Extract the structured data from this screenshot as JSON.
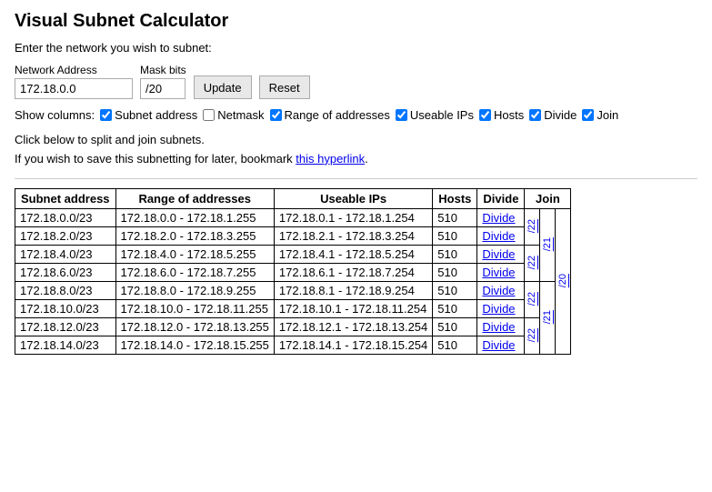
{
  "title": "Visual Subnet Calculator",
  "subtitle": "Enter the network you wish to subnet:",
  "network_label": "Network Address",
  "mask_label": "Mask bits",
  "network_value": "172.18.0.0",
  "mask_value": "/20",
  "update_btn": "Update",
  "reset_btn": "Reset",
  "show_columns_label": "Show columns:",
  "columns": [
    {
      "id": "subnet",
      "label": "Subnet address",
      "checked": true
    },
    {
      "id": "netmask",
      "label": "Netmask",
      "checked": false
    },
    {
      "id": "range",
      "label": "Range of addresses",
      "checked": true
    },
    {
      "id": "useable",
      "label": "Useable IPs",
      "checked": true
    },
    {
      "id": "hosts",
      "label": "Hosts",
      "checked": true
    },
    {
      "id": "divide",
      "label": "Divide",
      "checked": true
    },
    {
      "id": "join",
      "label": "Join",
      "checked": true
    }
  ],
  "info_line1": "Click below to split and join subnets.",
  "info_line2": "If you wish to save this subnetting for later, bookmark ",
  "hyperlink_text": "this hyperlink",
  "info_line2_end": ".",
  "table_headers": {
    "subnet": "Subnet address",
    "range": "Range of addresses",
    "useable": "Useable IPs",
    "hosts": "Hosts",
    "divide": "Divide",
    "join": "Join"
  },
  "rows": [
    {
      "subnet": "172.18.0.0/23",
      "range": "172.18.0.0 - 172.18.1.255",
      "useable": "172.18.0.1 - 172.18.1.254",
      "hosts": "510"
    },
    {
      "subnet": "172.18.2.0/23",
      "range": "172.18.2.0 - 172.18.3.255",
      "useable": "172.18.2.1 - 172.18.3.254",
      "hosts": "510"
    },
    {
      "subnet": "172.18.4.0/23",
      "range": "172.18.4.0 - 172.18.5.255",
      "useable": "172.18.4.1 - 172.18.5.254",
      "hosts": "510"
    },
    {
      "subnet": "172.18.6.0/23",
      "range": "172.18.6.0 - 172.18.7.255",
      "useable": "172.18.6.1 - 172.18.7.254",
      "hosts": "510"
    },
    {
      "subnet": "172.18.8.0/23",
      "range": "172.18.8.0 - 172.18.9.255",
      "useable": "172.18.8.1 - 172.18.9.254",
      "hosts": "510"
    },
    {
      "subnet": "172.18.10.0/23",
      "range": "172.18.10.0 - 172.18.11.255",
      "useable": "172.18.10.1 - 172.18.11.254",
      "hosts": "510"
    },
    {
      "subnet": "172.18.12.0/23",
      "range": "172.18.12.0 - 172.18.13.255",
      "useable": "172.18.12.1 - 172.18.13.254",
      "hosts": "510"
    },
    {
      "subnet": "172.18.14.0/23",
      "range": "172.18.14.0 - 172.18.15.255",
      "useable": "172.18.14.1 - 172.18.15.254",
      "hosts": "510"
    }
  ],
  "join_columns": [
    {
      "label": "/22",
      "rows": [
        {
          "pairs": [
            [
              0,
              1
            ]
          ],
          "label": "/22"
        },
        {
          "pairs": [
            [
              2,
              3
            ]
          ],
          "label": "/22"
        },
        {
          "pairs": [
            [
              4,
              5
            ]
          ],
          "label": "/22"
        },
        {
          "pairs": [
            [
              6,
              7
            ]
          ],
          "label": "/22"
        }
      ]
    },
    {
      "label": "/21",
      "rows": [
        {
          "pairs": [
            [
              0,
              1,
              2,
              3
            ]
          ],
          "label": "/21"
        },
        {
          "pairs": [
            [
              4,
              5,
              6,
              7
            ]
          ],
          "label": "/21"
        }
      ]
    },
    {
      "label": "/20",
      "rows": [
        {
          "pairs": [
            [
              0,
              1,
              2,
              3,
              4,
              5,
              6,
              7
            ]
          ],
          "label": "/20"
        }
      ]
    }
  ]
}
